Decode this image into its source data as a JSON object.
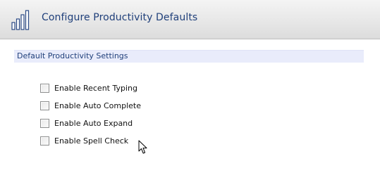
{
  "header": {
    "title": "Configure Productivity Defaults",
    "icon": "productivity-bars-icon",
    "accent_color": "#1f3f7a"
  },
  "section": {
    "title": "Default Productivity Settings",
    "background_color": "#e9ecfb"
  },
  "options": [
    {
      "label": "Enable Recent Typing",
      "checked": false
    },
    {
      "label": "Enable Auto Complete",
      "checked": false
    },
    {
      "label": "Enable Auto Expand",
      "checked": false
    },
    {
      "label": "Enable Spell Check",
      "checked": false
    }
  ],
  "pointer": {
    "icon": "mouse-cursor-icon"
  }
}
